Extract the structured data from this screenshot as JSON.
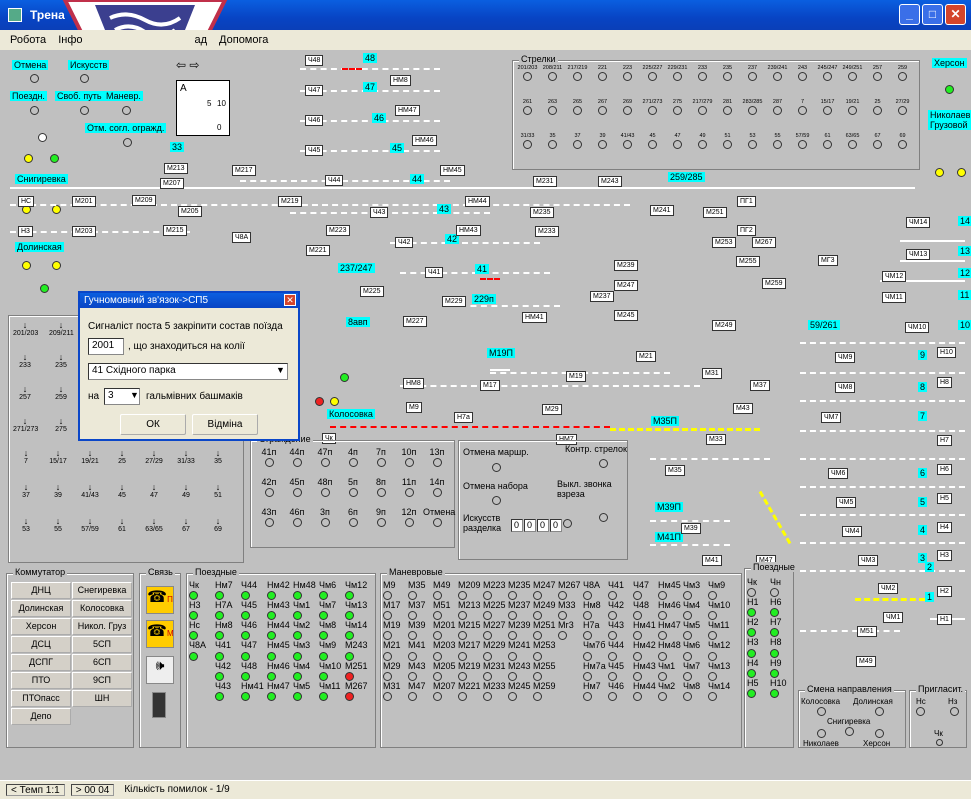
{
  "window": {
    "title": "Трена"
  },
  "menu": [
    "Робота",
    "Інфо",
    "ад",
    "Допомога"
  ],
  "status": {
    "tempo": "< Темп 1:1",
    "time": "> 00 04",
    "errors": "Кількість помилок - 1/9"
  },
  "left_buttons": [
    "Отмена",
    "Искусств",
    "Поездн.",
    "Своб. путь",
    "Маневр.",
    "Отм. согл. огражд."
  ],
  "stations": {
    "snigirevka": "Снигиревка",
    "dolinskaya": "Долинская",
    "kolosovka": "Колосовка",
    "kherson": "Херсон",
    "nikolaev": "Николаев Грузовой"
  },
  "strelki_title": "Стрелки",
  "strelki_row1": [
    "201/203",
    "208/211",
    "217/219",
    "221",
    "223",
    "225/227",
    "229/231",
    "233",
    "235",
    "237",
    "239/241",
    "243",
    "245/247",
    "249/251",
    "257",
    "259"
  ],
  "strelki_row2": [
    "261",
    "263",
    "265",
    "267",
    "269",
    "271/273",
    "275",
    "217/279",
    "281",
    "283/285",
    "287",
    "7",
    "15/17",
    "19/21",
    "25",
    "27/29"
  ],
  "strelki_row3": [
    "31/33",
    "35",
    "37",
    "39",
    "41/43",
    "45",
    "47",
    "49",
    "51",
    "53",
    "55",
    "57/59",
    "61",
    "63/65",
    "67",
    "69"
  ],
  "left_strelki": {
    "r1": [
      "201/203",
      "209/211"
    ],
    "r2": [
      "233",
      "235"
    ],
    "r3": [
      "257",
      "259"
    ],
    "r4": [
      "271/273",
      "275"
    ],
    "r5": [
      "7",
      "15/17",
      "19/21",
      "25",
      "27/29",
      "31/33",
      "35"
    ],
    "r6": [
      "37",
      "39",
      "41/43",
      "45",
      "47",
      "49",
      "51"
    ],
    "r7": [
      "53",
      "55",
      "57/59",
      "61",
      "63/65",
      "67",
      "69"
    ]
  },
  "dialog": {
    "title": "Гучномовний зв'язок->СП5",
    "line1": "Сигналіст поста 5 закріпити состав поїзда",
    "train_no": "2001",
    "train_suffix": ", що знаходиться на колії",
    "track": "41 Східного парка",
    "on_label": "на",
    "shoes": "3",
    "shoes_suffix": "гальмівних башмаків",
    "ok": "ОК",
    "cancel": "Відміна"
  },
  "track_labels": {
    "t48": "48",
    "t47": "47",
    "t46": "46",
    "t45": "45",
    "t44": "44",
    "t43": "43",
    "t42": "42",
    "t41": "41",
    "t33": "33",
    "t229p": "229п",
    "t237_247": "237/247",
    "t8avp": "8авп",
    "t259_285": "259/285",
    "t59_261": "59/261",
    "m19p": "М19П",
    "m35p": "М35П",
    "m39p": "М39П",
    "m41p": "М41П",
    "r14": "14",
    "r13": "13",
    "r12": "12",
    "r11": "11",
    "r10": "10",
    "r9": "9",
    "r8": "8",
    "r7": "7",
    "r6": "6",
    "r5": "5",
    "r4": "4",
    "r3": "3",
    "r2": "2",
    "r1": "1"
  },
  "signals": {
    "ch48": "Ч48",
    "ch47": "Ч47",
    "ch46": "Ч46",
    "ch45": "Ч45",
    "ch44": "Ч44",
    "ch43": "Ч43",
    "ch42": "Ч42",
    "ch41": "Ч41",
    "nm8": "НМ8",
    "nm47": "НМ47",
    "nm46": "НМ46",
    "nm45": "НМ45",
    "nm44": "НМ44",
    "nm43": "НМ43",
    "nm41": "НМ41",
    "nc": "НС",
    "n3": "Н3",
    "m201": "М201",
    "m203": "М203",
    "m207": "М207",
    "m209": "М209",
    "m205": "М205",
    "m213": "М213",
    "m215": "М215",
    "m217": "М217",
    "m219": "М219",
    "ch8a": "Ч8А",
    "m221": "М221",
    "m223": "М223",
    "m225": "М225",
    "m227": "М227",
    "m229": "М229",
    "m231": "М231",
    "m235": "М235",
    "m233": "М233",
    "m243": "М243",
    "m241": "М241",
    "m251": "М251",
    "pg1": "ПГ1",
    "pg2": "ПГ2",
    "m253": "М253",
    "m267": "М267",
    "m255": "М255",
    "mg3": "МГ3",
    "m259": "М259",
    "m239": "М239",
    "m247": "М247",
    "m237": "М237",
    "m245": "М245",
    "m249": "М249",
    "m21": "М21",
    "m19": "М19",
    "m17": "М17",
    "nm8b": "НМ8",
    "m9": "М9",
    "n7a": "Н7а",
    "m29": "М29",
    "hm7": "НМ7",
    "chk": "Чк",
    "m37": "М37",
    "m43": "М43",
    "m33": "М33",
    "m35": "М35",
    "m39": "М39",
    "m41": "М41",
    "m47": "М47",
    "m31": "М31",
    "chm14": "ЧМ14",
    "chm13": "ЧМ13",
    "chm12": "ЧМ12",
    "chm11": "ЧМ11",
    "chm10": "ЧМ10",
    "chm9": "ЧМ9",
    "chm8": "ЧМ8",
    "chm7": "ЧМ7",
    "chm6": "ЧМ6",
    "chm5": "ЧМ5",
    "chm4": "ЧМ4",
    "chm3": "ЧМ3",
    "chm2": "ЧМ2",
    "chm1": "ЧМ1",
    "h10": "Н10",
    "h8": "Н8",
    "h7": "Н7",
    "h6": "Н6",
    "h5": "Н5",
    "h4": "Н4",
    "h3": "Н3",
    "h2": "Н2",
    "h1": "Н1",
    "m51": "М51",
    "m49": "М49"
  },
  "ograzhdenie": {
    "title": "Ограждение",
    "row1": [
      "41п",
      "44п",
      "47п",
      "4п",
      "7п",
      "10п",
      "13п"
    ],
    "row2": [
      "42п",
      "45п",
      "48п",
      "5п",
      "8п",
      "11п",
      "14п"
    ],
    "row3": [
      "43п",
      "46п",
      "3п",
      "6п",
      "9п",
      "12п",
      "Отмена"
    ]
  },
  "control": {
    "cancel_route": "Отмена маршр.",
    "check_switches": "Контр. стрелок",
    "cancel_set": "Отмена набора",
    "bell_off": "Выкл. звонка взреза",
    "artificial": "Искусств разделка",
    "counter": [
      "0",
      "0",
      "0",
      "0"
    ]
  },
  "commutator": {
    "title": "Коммутатор",
    "buttons": [
      [
        "ДНЦ",
        "Снегиревка"
      ],
      [
        "Долинская",
        "Колосовка"
      ],
      [
        "Херсон",
        "Никол. Груз"
      ],
      [
        "ДСЦ",
        "5СП"
      ],
      [
        "ДСПГ",
        "6СП"
      ],
      [
        "ПТО",
        "9СП"
      ],
      [
        "ПТОпасс",
        "ШН"
      ],
      [
        "Депо",
        ""
      ]
    ]
  },
  "svyaz": {
    "title": "Связь",
    "p": "П",
    "m": "М"
  },
  "poezdnye_left": {
    "title": "Поездные",
    "rows": [
      [
        "Чк",
        "Нм7",
        "Ч44",
        "Нм42",
        "Нм48",
        "Чм6",
        "Чм12"
      ],
      [
        "Н3",
        "Н7А",
        "Ч45",
        "Нм43",
        "Чм1",
        "Чм7",
        "Чм13"
      ],
      [
        "Нс",
        "Нм8",
        "Ч46",
        "Нм44",
        "Чм2",
        "Чм8",
        "Чм14"
      ],
      [
        "Ч8А",
        "Ч41",
        "Ч47",
        "Нм45",
        "Чм3",
        "Чм9",
        "М243"
      ],
      [
        "",
        "Ч42",
        "Ч48",
        "Нм46",
        "Чм4",
        "Чм10",
        "М251"
      ],
      [
        "",
        "Ч43",
        "Нм41",
        "Нм47",
        "Чм5",
        "Чм11",
        "М267"
      ]
    ]
  },
  "manevrovye": {
    "title": "Маневровые",
    "rows": [
      [
        "М9",
        "М35",
        "М49",
        "М209",
        "М223",
        "М235",
        "М247",
        "М267",
        "Ч8А",
        "Ч41",
        "Ч47",
        "Нм45",
        "Чм3",
        "Чм9"
      ],
      [
        "М17",
        "М37",
        "М51",
        "М213",
        "М225",
        "М237",
        "М249",
        "М33",
        "Нм8",
        "Ч42",
        "Ч48",
        "Нм46",
        "Чм4",
        "Чм10"
      ],
      [
        "М19",
        "М39",
        "М201",
        "М215",
        "М227",
        "М239",
        "М251",
        "Мг3",
        "Н7а",
        "Ч43",
        "Нм41",
        "Нм47",
        "Чм5",
        "Чм11"
      ],
      [
        "М21",
        "М41",
        "М203",
        "М217",
        "М229",
        "М241",
        "М253",
        "",
        "Чм7б",
        "Ч44",
        "Нм42",
        "Нм48",
        "Чм6",
        "Чм12"
      ],
      [
        "М29",
        "М43",
        "М205",
        "М219",
        "М231",
        "М243",
        "М255",
        "",
        "Нм7а",
        "Ч45",
        "Нм43",
        "Чм1",
        "Чм7",
        "Чм13"
      ],
      [
        "М31",
        "М47",
        "М207",
        "М221",
        "М233",
        "М245",
        "М259",
        "",
        "Нм7",
        "Ч46",
        "Нм44",
        "Чм2",
        "Чм8",
        "Чм14"
      ]
    ]
  },
  "poezdnye_right": {
    "title": "Поездные",
    "rows": [
      [
        "Чк",
        "Чн"
      ],
      [
        "Н1",
        "Н6"
      ],
      [
        "Н2",
        "Н7"
      ],
      [
        "Н3",
        "Н8"
      ],
      [
        "Н4",
        "Н9"
      ],
      [
        "Н5",
        "Н10"
      ]
    ]
  },
  "direction": {
    "title": "Смена направления",
    "kolosovka": "Колосовка",
    "dolinskaya": "Долинская",
    "snigirevka": "Снигиревка",
    "nikolaev": "Николаев",
    "kherson": "Херсон"
  },
  "invite": {
    "title": "Пригласит.",
    "nc": "Нс",
    "n3": "Нз",
    "chk": "Чк"
  },
  "switch_box": {
    "a": "А",
    "five": "5",
    "ten": "10",
    "zero": "0"
  }
}
